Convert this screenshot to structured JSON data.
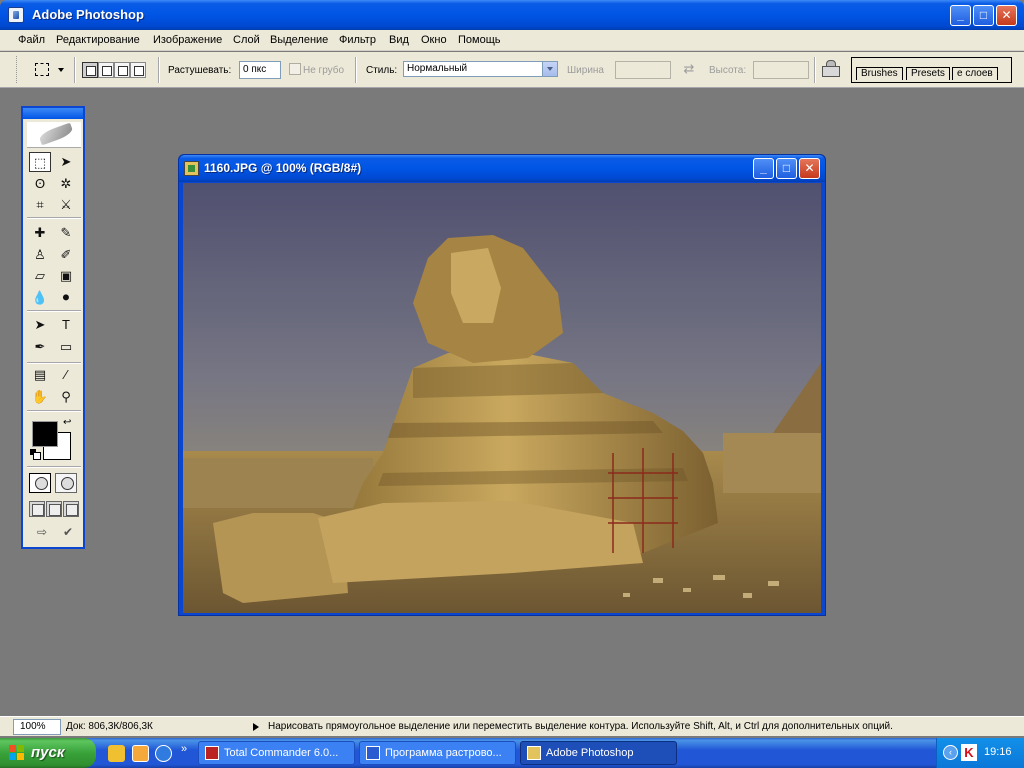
{
  "window": {
    "title": "Adobe Photoshop",
    "buttons": {
      "minimize": "_",
      "maximize": "□",
      "close": "✕"
    }
  },
  "menu": [
    "Файл",
    "Редактирование",
    "Изображение",
    "Слой",
    "Выделение",
    "Фильтр",
    "Вид",
    "Окно",
    "Помощь"
  ],
  "options": {
    "feather_label": "Растушевать:",
    "feather_value": "0 пкс",
    "antialias_label": "Не грубо",
    "style_label": "Стиль:",
    "style_value": "Нормальный",
    "width_label": "Ширина",
    "width_value": "",
    "height_label": "Высота:",
    "height_value": "",
    "palette_tabs": [
      "Brushes",
      "Presets",
      "е слоев"
    ]
  },
  "toolbox": {
    "tools": [
      [
        "rect-marquee-tool",
        "⬚"
      ],
      [
        "move-tool",
        "➤"
      ],
      [
        "lasso-tool",
        "ʘ"
      ],
      [
        "magic-wand-tool",
        "✲"
      ],
      [
        "crop-tool",
        "⌗"
      ],
      [
        "slice-tool",
        "⚔"
      ],
      [
        "healing-brush-tool",
        "✚"
      ],
      [
        "brush-tool",
        "✎"
      ],
      [
        "clone-stamp-tool",
        "♙"
      ],
      [
        "history-brush-tool",
        "✐"
      ],
      [
        "eraser-tool",
        "▱"
      ],
      [
        "gradient-tool",
        "▣"
      ],
      [
        "blur-tool",
        "💧"
      ],
      [
        "dodge-tool",
        "⚫"
      ],
      [
        "path-selection-tool",
        "➤"
      ],
      [
        "type-tool",
        "T"
      ],
      [
        "pen-tool",
        "✒"
      ],
      [
        "shape-tool",
        "▭"
      ],
      [
        "notes-tool",
        "▤"
      ],
      [
        "eyedropper-tool",
        "⁄"
      ],
      [
        "hand-tool",
        "✋"
      ],
      [
        "zoom-tool",
        "⚲"
      ]
    ],
    "foreground_color": "#000000",
    "background_color": "#ffffff"
  },
  "document": {
    "title": "1160.JPG @ 100% (RGB/8#)"
  },
  "status": {
    "zoom": "100%",
    "doc_info": "Док: 806,3К/806,3К",
    "message": "Нарисовать прямоугольное выделение или переместить выделение контура. Используйте Shift, Alt, и Ctrl для дополнительных опций."
  },
  "taskbar": {
    "start_label": "пуск",
    "tasks": [
      "Total Commander 6.0...",
      "Программа растрово...",
      "Adobe Photoshop"
    ],
    "clock": "19:16"
  }
}
